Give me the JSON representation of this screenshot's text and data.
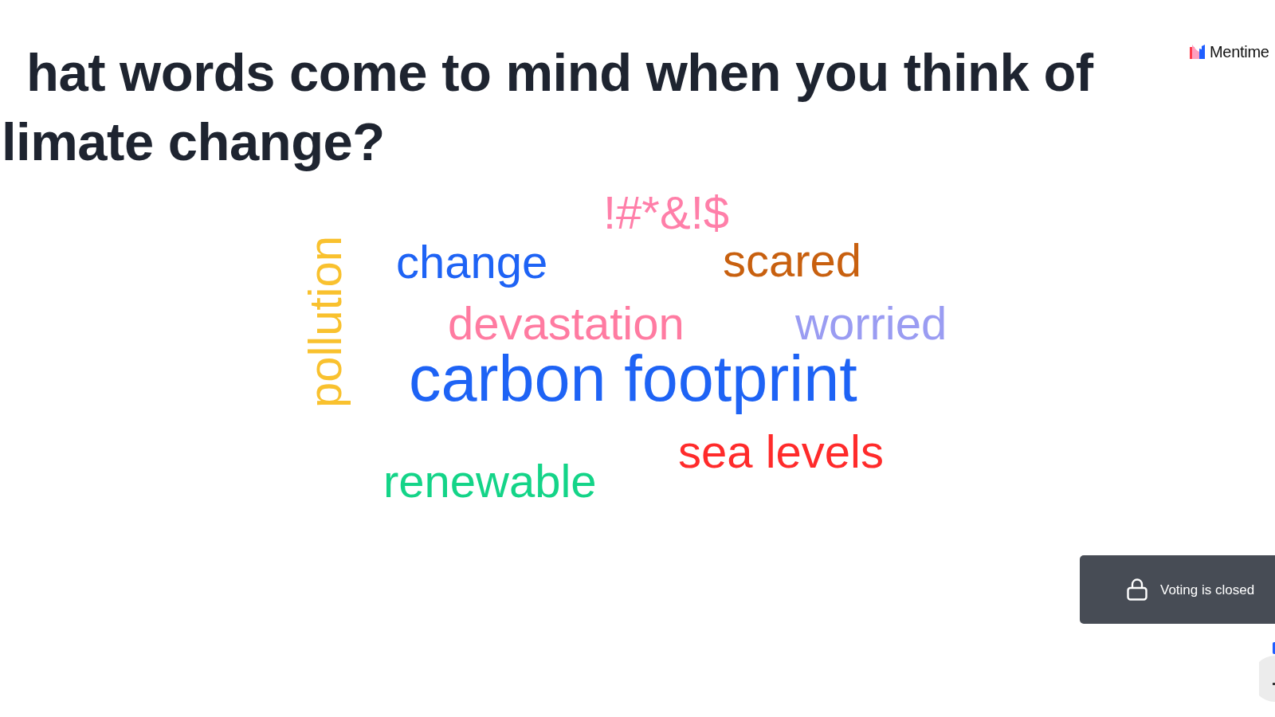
{
  "question": {
    "title": "hat words come to mind when you think of limate change?"
  },
  "brand": {
    "name": "Mentime"
  },
  "word_cloud": {
    "words": [
      {
        "text": "!#*&!$",
        "color": "#ff7fa9",
        "kind": "regular",
        "vertical": false
      },
      {
        "text": "pollution",
        "color": "#f9c12e",
        "kind": "regular",
        "vertical": true
      },
      {
        "text": "change",
        "color": "#1e63f5",
        "kind": "regular",
        "vertical": false
      },
      {
        "text": "scared",
        "color": "#c8600f",
        "kind": "regular",
        "vertical": false
      },
      {
        "text": "devastation",
        "color": "#ff7ba1",
        "kind": "regular",
        "vertical": false
      },
      {
        "text": "worried",
        "color": "#9a9cf2",
        "kind": "regular",
        "vertical": false
      },
      {
        "text": "carbon footprint",
        "color": "#1e63f5",
        "kind": "large",
        "vertical": false
      },
      {
        "text": "sea levels",
        "color": "#ff2b2b",
        "kind": "regular",
        "vertical": false
      },
      {
        "text": "renewable",
        "color": "#14d488",
        "kind": "regular",
        "vertical": false
      }
    ]
  },
  "status_banner": {
    "text": "Voting is closed"
  }
}
